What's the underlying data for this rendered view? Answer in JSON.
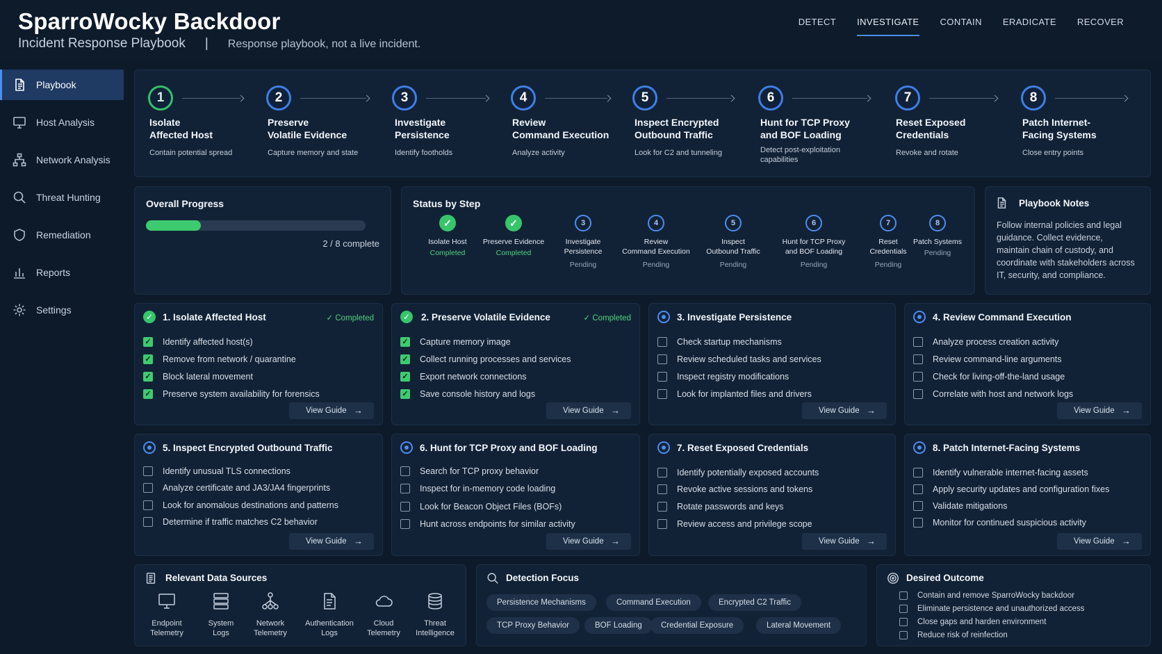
{
  "header": {
    "title": "SparroWocky Backdoor",
    "subtitle": "Incident Response Playbook",
    "separator": "|",
    "note": "Response playbook, not a live incident."
  },
  "topnav": [
    "DETECT",
    "INVESTIGATE",
    "CONTAIN",
    "ERADICATE",
    "RECOVER"
  ],
  "sidebar": {
    "items": [
      {
        "label": "Playbook",
        "icon": "document-icon"
      },
      {
        "label": "Host Analysis",
        "icon": "monitor-icon"
      },
      {
        "label": "Network Analysis",
        "icon": "network-icon"
      },
      {
        "label": "Threat Hunting",
        "icon": "search-icon"
      },
      {
        "label": "Remediation",
        "icon": "shield-icon"
      },
      {
        "label": "Reports",
        "icon": "bar-chart-icon"
      },
      {
        "label": "Settings",
        "icon": "gear-icon"
      }
    ]
  },
  "steps": [
    {
      "num": "1",
      "title1": "Isolate",
      "title2": "Affected Host",
      "desc": "Contain potential spread"
    },
    {
      "num": "2",
      "title1": "Preserve",
      "title2": "Volatile Evidence",
      "desc": "Capture memory and state"
    },
    {
      "num": "3",
      "title1": "Investigate",
      "title2": "Persistence",
      "desc": "Identify footholds"
    },
    {
      "num": "4",
      "title1": "Review",
      "title2": "Command Execution",
      "desc": "Analyze activity"
    },
    {
      "num": "5",
      "title1": "Inspect Encrypted",
      "title2": "Outbound Traffic",
      "desc": "Look for C2 and tunneling"
    },
    {
      "num": "6",
      "title1": "Hunt for TCP Proxy",
      "title2": "and BOF Loading",
      "desc": "Detect post-exploitation capabilities"
    },
    {
      "num": "7",
      "title1": "Reset Exposed",
      "title2": "Credentials",
      "desc": "Revoke and rotate"
    },
    {
      "num": "8",
      "title1": "Patch Internet-",
      "title2": "Facing Systems",
      "desc": "Close entry points"
    }
  ],
  "progress": {
    "title": "Overall Progress",
    "fraction": 0.25,
    "text": "2 / 8 complete"
  },
  "status_by_step": {
    "title": "Status by Step",
    "items": [
      {
        "num": "✓",
        "l1": "Isolate Host",
        "l2": "",
        "status": "Completed"
      },
      {
        "num": "✓",
        "l1": "Preserve Evidence",
        "l2": "",
        "status": "Completed"
      },
      {
        "num": "3",
        "l1": "Investigate",
        "l2": "Persistence",
        "status": "Pending"
      },
      {
        "num": "4",
        "l1": "Review",
        "l2": "Command Execution",
        "status": "Pending"
      },
      {
        "num": "5",
        "l1": "Inspect",
        "l2": "Outbound Traffic",
        "status": "Pending"
      },
      {
        "num": "6",
        "l1": "Hunt for TCP Proxy",
        "l2": "and BOF Loading",
        "status": "Pending"
      },
      {
        "num": "7",
        "l1": "Reset",
        "l2": "Credentials",
        "status": "Pending"
      },
      {
        "num": "8",
        "l1": "Patch Systems",
        "l2": "",
        "status": "Pending"
      }
    ]
  },
  "notes": {
    "title": "Playbook Notes",
    "text": "Follow internal policies and legal guidance. Collect evidence, maintain chain of custody, and coordinate with stakeholders across IT, security, and compliance."
  },
  "cards": [
    {
      "title": "1. Isolate Affected Host",
      "status": "Completed",
      "tasks": [
        "Identify affected host(s)",
        "Remove from network / quarantine",
        "Block lateral movement",
        "Preserve system availability for forensics"
      ]
    },
    {
      "title": "2. Preserve Volatile Evidence",
      "status": "Completed",
      "tasks": [
        "Capture memory image",
        "Collect running processes and services",
        "Export network connections",
        "Save console history and logs"
      ]
    },
    {
      "title": "3. Investigate Persistence",
      "status": "",
      "tasks": [
        "Check startup mechanisms",
        "Review scheduled tasks and services",
        "Inspect registry modifications",
        "Look for implanted files and drivers"
      ]
    },
    {
      "title": "4. Review Command Execution",
      "status": "",
      "tasks": [
        "Analyze process creation activity",
        "Review command-line arguments",
        "Check for living-off-the-land usage",
        "Correlate with host and network logs"
      ]
    },
    {
      "title": "5. Inspect Encrypted Outbound Traffic",
      "status": "",
      "tasks": [
        "Identify unusual TLS connections",
        "Analyze certificate and JA3/JA4 fingerprints",
        "Look for anomalous destinations and patterns",
        "Determine if traffic matches C2 behavior"
      ]
    },
    {
      "title": "6. Hunt for TCP Proxy and BOF Loading",
      "status": "",
      "tasks": [
        "Search for TCP proxy behavior",
        "Inspect for in-memory code loading",
        "Look for Beacon Object Files (BOFs)",
        "Hunt across endpoints for similar activity"
      ]
    },
    {
      "title": "7. Reset Exposed Credentials",
      "status": "",
      "tasks": [
        "Identify potentially exposed accounts",
        "Revoke active sessions and tokens",
        "Rotate passwords and keys",
        "Review access and privilege scope"
      ]
    },
    {
      "title": "8. Patch Internet-Facing Systems",
      "status": "",
      "tasks": [
        "Identify vulnerable internet-facing assets",
        "Apply security updates and configuration fixes",
        "Validate mitigations",
        "Monitor for continued suspicious activity"
      ]
    }
  ],
  "guide_label": "View Guide",
  "data_sources": {
    "title": "Relevant Data Sources",
    "items": [
      {
        "l1": "Endpoint",
        "l2": "Telemetry",
        "icon": "monitor-icon"
      },
      {
        "l1": "System",
        "l2": "Logs",
        "icon": "server-icon"
      },
      {
        "l1": "Network",
        "l2": "Telemetry",
        "icon": "network-icon"
      },
      {
        "l1": "Authentication",
        "l2": "Logs",
        "icon": "document-icon"
      },
      {
        "l1": "Cloud",
        "l2": "Telemetry",
        "icon": "cloud-icon"
      },
      {
        "l1": "Threat",
        "l2": "Intelligence",
        "icon": "database-icon"
      }
    ]
  },
  "detection_focus": {
    "title": "Detection Focus",
    "tags": [
      "Persistence Mechanisms",
      "Command Execution",
      "Encrypted C2 Traffic",
      "TCP Proxy Behavior",
      "BOF Loading",
      "Credential Exposure",
      "Lateral Movement"
    ]
  },
  "desired_outcome": {
    "title": "Desired Outcome",
    "items": [
      "Contain and remove SparroWocky backdoor",
      "Eliminate persistence and unauthorized access",
      "Close gaps and harden environment",
      "Reduce risk of reinfection"
    ]
  }
}
